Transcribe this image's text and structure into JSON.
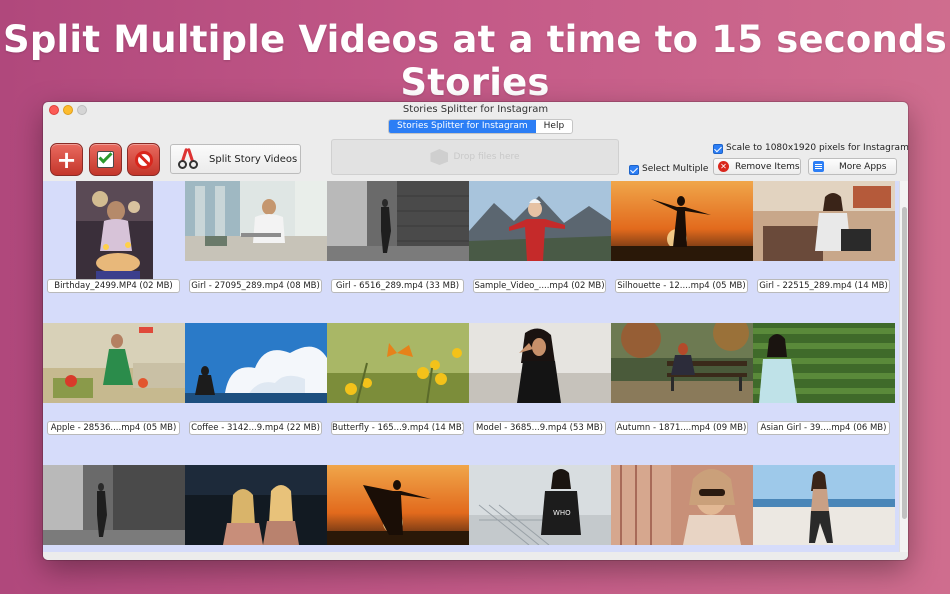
{
  "headline": "Split Multiple Videos at a time to 15 seconds Stories",
  "window": {
    "title": "Stories Splitter for Instagram",
    "tabs": [
      {
        "label": "Stories Splitter for Instagram",
        "active": true
      },
      {
        "label": "Help",
        "active": false
      }
    ]
  },
  "toolbar": {
    "add_icon": "plus-icon",
    "select_icon": "checkmark-icon",
    "clear_icon": "ban-icon",
    "split_label": "Split Story Videos",
    "split_icon": "scissors-icon",
    "drop_placeholder": "Drop files here",
    "select_multiple": {
      "label": "Select Multiple",
      "checked": true
    },
    "scale": {
      "label": "Scale to 1080x1920 pixels for Instagram",
      "checked": true
    },
    "remove_label": "Remove Items",
    "more_apps_label": "More Apps"
  },
  "colors": {
    "accent": "#2c7ef5",
    "toolbar_red": "#c4362b",
    "grid_bg": "#d6dcfa"
  },
  "videos": [
    {
      "label": "Birthday_2499.MP4 (02 MB)"
    },
    {
      "label": "Girl - 27095_289.mp4 (08 MB)"
    },
    {
      "label": "Girl - 6516_289.mp4 (33 MB)"
    },
    {
      "label": "Sample_Video_....mp4 (02 MB)"
    },
    {
      "label": "Silhouette - 12....mp4 (05 MB)"
    },
    {
      "label": "Girl - 22515_289.mp4 (14 MB)"
    },
    {
      "label": "Apple - 28536....mp4 (05 MB)"
    },
    {
      "label": "Coffee - 3142...9.mp4 (22 MB)"
    },
    {
      "label": "Butterfly - 165...9.mp4 (14 MB)"
    },
    {
      "label": "Model - 3685...9.mp4 (53 MB)"
    },
    {
      "label": "Autumn - 1871....mp4 (09 MB)"
    },
    {
      "label": "Asian Girl - 39....mp4 (06 MB)"
    },
    {
      "label": ""
    },
    {
      "label": ""
    },
    {
      "label": ""
    },
    {
      "label": ""
    },
    {
      "label": ""
    },
    {
      "label": ""
    }
  ]
}
